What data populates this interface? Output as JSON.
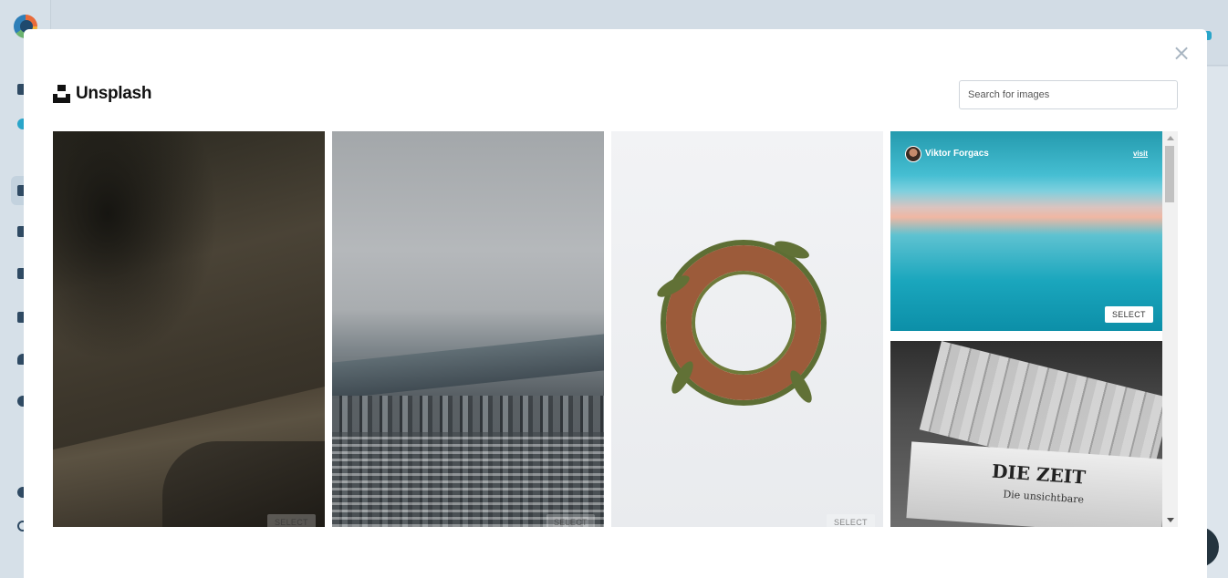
{
  "modal": {
    "close_icon": "×",
    "brand": {
      "name": "Unsplash"
    },
    "search": {
      "placeholder": "Search for images",
      "value": ""
    },
    "photos": [
      {
        "select_label": "SELECT"
      },
      {
        "select_label": "SELECT"
      },
      {
        "select_label": "SELECT"
      },
      {
        "author": "Viktor Forgacs",
        "visit_label": "visit",
        "select_label": "SELECT"
      },
      {
        "headline": "DIE ZEIT",
        "subtitle": "Die unsichtbare"
      }
    ]
  },
  "colors": {
    "accent": "#2aa5c9",
    "modal_bg": "#ffffff",
    "app_bg": "#cfd9e2"
  }
}
